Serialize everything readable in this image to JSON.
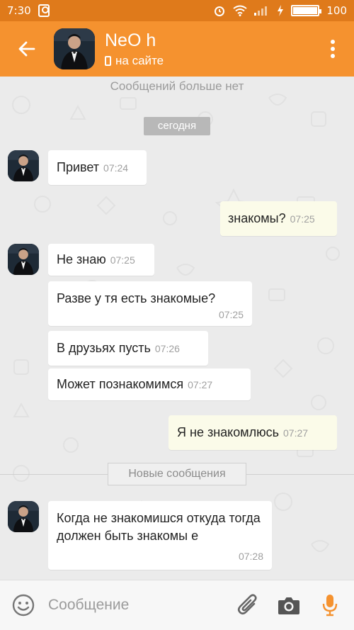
{
  "status_bar": {
    "time": "7:30",
    "battery": "100",
    "battery_level": 1.0
  },
  "header": {
    "contact_name": "NeO h",
    "contact_status": "на сайте",
    "back_icon": "arrow-left-icon",
    "menu_icon": "more-vert-icon"
  },
  "chat": {
    "no_more": "Сообщений больше нет",
    "day_label": "сегодня",
    "new_messages_label": "Новые сообщения",
    "messages": [
      {
        "dir": "in",
        "text": "Привет",
        "time": "07:24"
      },
      {
        "dir": "out",
        "text": "знакомы?",
        "time": "07:25"
      },
      {
        "dir": "in",
        "text": "Не знаю",
        "time": "07:25"
      },
      {
        "dir": "in",
        "text": "Разве у тя есть знакомые?",
        "time": "07:25"
      },
      {
        "dir": "in",
        "text": "В друзьях пусть",
        "time": "07:26"
      },
      {
        "dir": "in",
        "text": "Может познакомимся",
        "time": "07:27"
      },
      {
        "dir": "out",
        "text": "Я не знакомлюсь",
        "time": "07:27"
      },
      {
        "dir": "in",
        "text": "Когда не знакомишся откуда тогда должен быть знакомы е",
        "time": "07:28"
      }
    ]
  },
  "composer": {
    "placeholder": "Сообщение",
    "icons": [
      "emoji-icon",
      "attach-icon",
      "camera-icon",
      "mic-icon"
    ]
  },
  "colors": {
    "accent": "#f5922f",
    "status_bar": "#df7a1b",
    "mic": "#f5922f"
  }
}
